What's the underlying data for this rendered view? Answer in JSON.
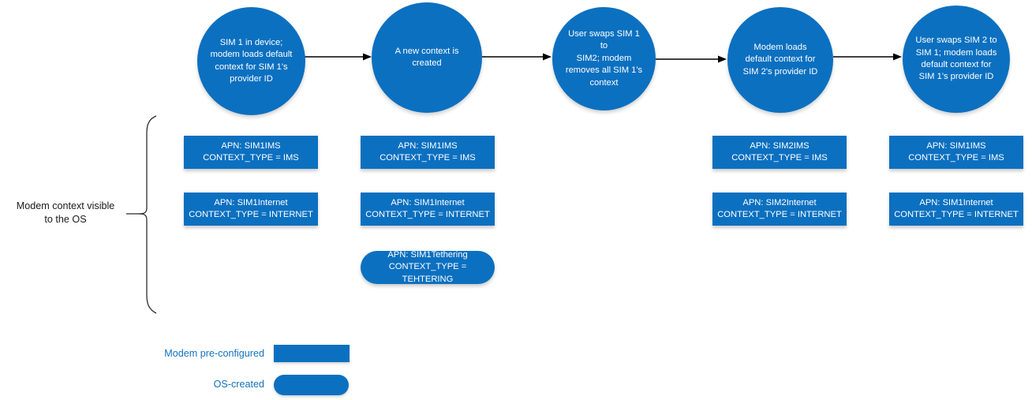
{
  "diagram": {
    "title": "Modem context lifecycle across SIM swaps",
    "accent_color": "#0c70c0",
    "legend_text_color": "#1272bd",
    "arrow_color": "#000000"
  },
  "stages": [
    {
      "id": "stage-1",
      "text": "SIM 1 in device;\nmodem loads default\ncontext for SIM 1's\nprovider ID"
    },
    {
      "id": "stage-2",
      "text": "A new context is\ncreated"
    },
    {
      "id": "stage-3",
      "text": "User swaps SIM 1 to\nSIM2; modem\nremoves all SIM 1's\ncontext"
    },
    {
      "id": "stage-4",
      "text": "Modem loads\ndefault context for\nSIM 2's provider ID"
    },
    {
      "id": "stage-5",
      "text": "User swaps SIM 2 to\nSIM 1; modem loads\ndefault context for\nSIM 1's provider ID"
    }
  ],
  "columns": [
    {
      "column": 1,
      "contexts": [
        {
          "id": "c1-ims",
          "shape": "rect",
          "text": "APN: SIM1IMS\nCONTEXT_TYPE = IMS",
          "apn": "SIM1IMS",
          "context_type": "IMS"
        },
        {
          "id": "c1-internet",
          "shape": "rect",
          "text": "APN: SIM1Internet\nCONTEXT_TYPE = INTERNET",
          "apn": "SIM1Internet",
          "context_type": "INTERNET"
        }
      ]
    },
    {
      "column": 2,
      "contexts": [
        {
          "id": "c2-ims",
          "shape": "rect",
          "text": "APN: SIM1IMS\nCONTEXT_TYPE = IMS",
          "apn": "SIM1IMS",
          "context_type": "IMS"
        },
        {
          "id": "c2-internet",
          "shape": "rect",
          "text": "APN: SIM1Internet\nCONTEXT_TYPE = INTERNET",
          "apn": "SIM1Internet",
          "context_type": "INTERNET"
        },
        {
          "id": "c2-tethering",
          "shape": "rounded",
          "text": "APN: SIM1Tethering\nCONTEXT_TYPE = TEHTERING",
          "apn": "SIM1Tethering",
          "context_type": "TEHTERING"
        }
      ]
    },
    {
      "column": 3,
      "contexts": []
    },
    {
      "column": 4,
      "contexts": [
        {
          "id": "c4-ims",
          "shape": "rect",
          "text": "APN: SIM2IMS\nCONTEXT_TYPE = IMS",
          "apn": "SIM2IMS",
          "context_type": "IMS"
        },
        {
          "id": "c4-internet",
          "shape": "rect",
          "text": "APN: SIM2Internet\nCONTEXT_TYPE = INTERNET",
          "apn": "SIM2Internet",
          "context_type": "INTERNET"
        }
      ]
    },
    {
      "column": 5,
      "contexts": [
        {
          "id": "c5-ims",
          "shape": "rect",
          "text": "APN: SIM1IMS\nCONTEXT_TYPE = IMS",
          "apn": "SIM1IMS",
          "context_type": "IMS"
        },
        {
          "id": "c5-internet",
          "shape": "rect",
          "text": "APN: SIM1Internet\nCONTEXT_TYPE = INTERNET",
          "apn": "SIM1Internet",
          "context_type": "INTERNET"
        }
      ]
    }
  ],
  "bracket": {
    "label": "Modem context visible\nto the OS"
  },
  "legend": {
    "items": [
      {
        "id": "legend-modem-preconfigured",
        "label": "Modem pre-configured",
        "shape": "rect"
      },
      {
        "id": "legend-os-created",
        "label": "OS-created",
        "shape": "pill"
      }
    ]
  }
}
